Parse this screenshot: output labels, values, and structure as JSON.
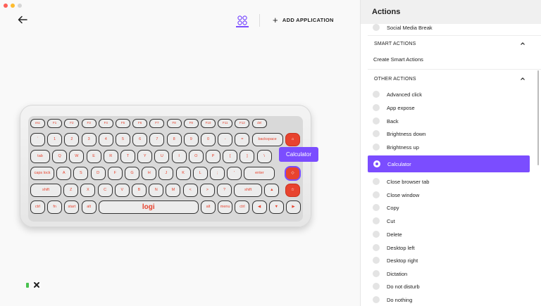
{
  "window": {
    "traffic_colors": [
      "#fe5f57",
      "#febc2e",
      "#d6d6d6"
    ]
  },
  "toolbar": {
    "add_application": "ADD APPLICATION",
    "accent": "#7b4dff"
  },
  "keyboard": {
    "brand": "logi",
    "fn_row": [
      "esc",
      "F1",
      "F2",
      "F3",
      "F4",
      "F5",
      "F6",
      "F7",
      "F8",
      "F9",
      "F10",
      "F11",
      "F12",
      "del"
    ],
    "num_row": [
      "`",
      "1",
      "2",
      "3",
      "4",
      "5",
      "6",
      "7",
      "8",
      "9",
      "0",
      "-",
      "=",
      "backspace"
    ],
    "q_row": [
      "tab",
      "Q",
      "W",
      "E",
      "R",
      "T",
      "Y",
      "U",
      "I",
      "O",
      "P",
      "[",
      "]",
      "\\"
    ],
    "a_row": [
      "caps lock",
      "A",
      "S",
      "D",
      "F",
      "G",
      "H",
      "J",
      "K",
      "L",
      ";",
      "'",
      "enter"
    ],
    "z_row": [
      "shift",
      "Z",
      "X",
      "C",
      "V",
      "B",
      "N",
      "M",
      "<",
      ">",
      "?",
      "shift",
      "▲"
    ],
    "bottom_row": [
      "ctrl",
      "fn",
      "start",
      "alt",
      "",
      "alt",
      "menu",
      "ctrl",
      "◀",
      "▼",
      "▶"
    ],
    "callout": "Calculator"
  },
  "panel": {
    "title": "Actions",
    "top_item": "Social Media Break",
    "smart_actions_header": "SMART ACTIONS",
    "create_smart_actions": "Create Smart Actions",
    "other_actions_header": "OTHER ACTIONS",
    "items": [
      "Advanced click",
      "App expose",
      "Back",
      "Brightness down",
      "Brightness up",
      "Calculator",
      "Close browser tab",
      "Close window",
      "Copy",
      "Cut",
      "Delete",
      "Desktop left",
      "Desktop right",
      "Dictation",
      "Do not disturb",
      "Do nothing"
    ],
    "selected_item": "Calculator"
  }
}
